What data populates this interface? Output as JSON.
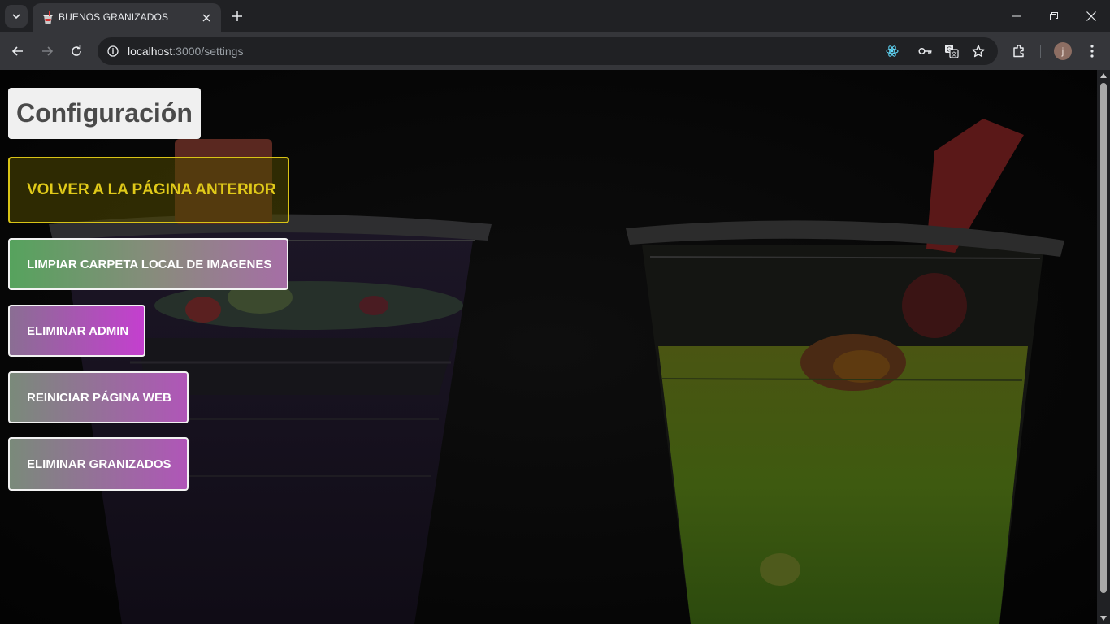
{
  "browser": {
    "tab_title": "BUENOS GRANIZADOS",
    "url_host": "localhost",
    "url_path": ":3000/settings",
    "profile_initial": "j"
  },
  "page": {
    "title": "Configuración",
    "buttons": {
      "back": "VOLVER A LA PÁGINA ANTERIOR",
      "clean_images": "LIMPIAR CARPETA LOCAL DE IMAGENES",
      "delete_admin": "ELIMINAR ADMIN",
      "reset_site": "REINICIAR PÁGINA WEB",
      "delete_granizados": "ELIMINAR GRANIZADOS"
    }
  },
  "colors": {
    "back_button_accent": "#d8c316",
    "title_background": "#f0f0f0",
    "page_background": "#050505"
  },
  "icons": {
    "tab_search": "chevron-down-icon",
    "favicon": "cup-icon",
    "tab_close": "close-icon",
    "new_tab": "plus-icon",
    "back": "arrow-left-icon",
    "forward": "arrow-right-icon",
    "reload": "reload-icon",
    "site_info": "info-icon",
    "react_devtools": "react-icon",
    "passwords": "key-icon",
    "translate": "translate-icon",
    "bookmark": "star-icon",
    "extensions": "puzzle-icon",
    "menu": "kebab-menu-icon"
  }
}
